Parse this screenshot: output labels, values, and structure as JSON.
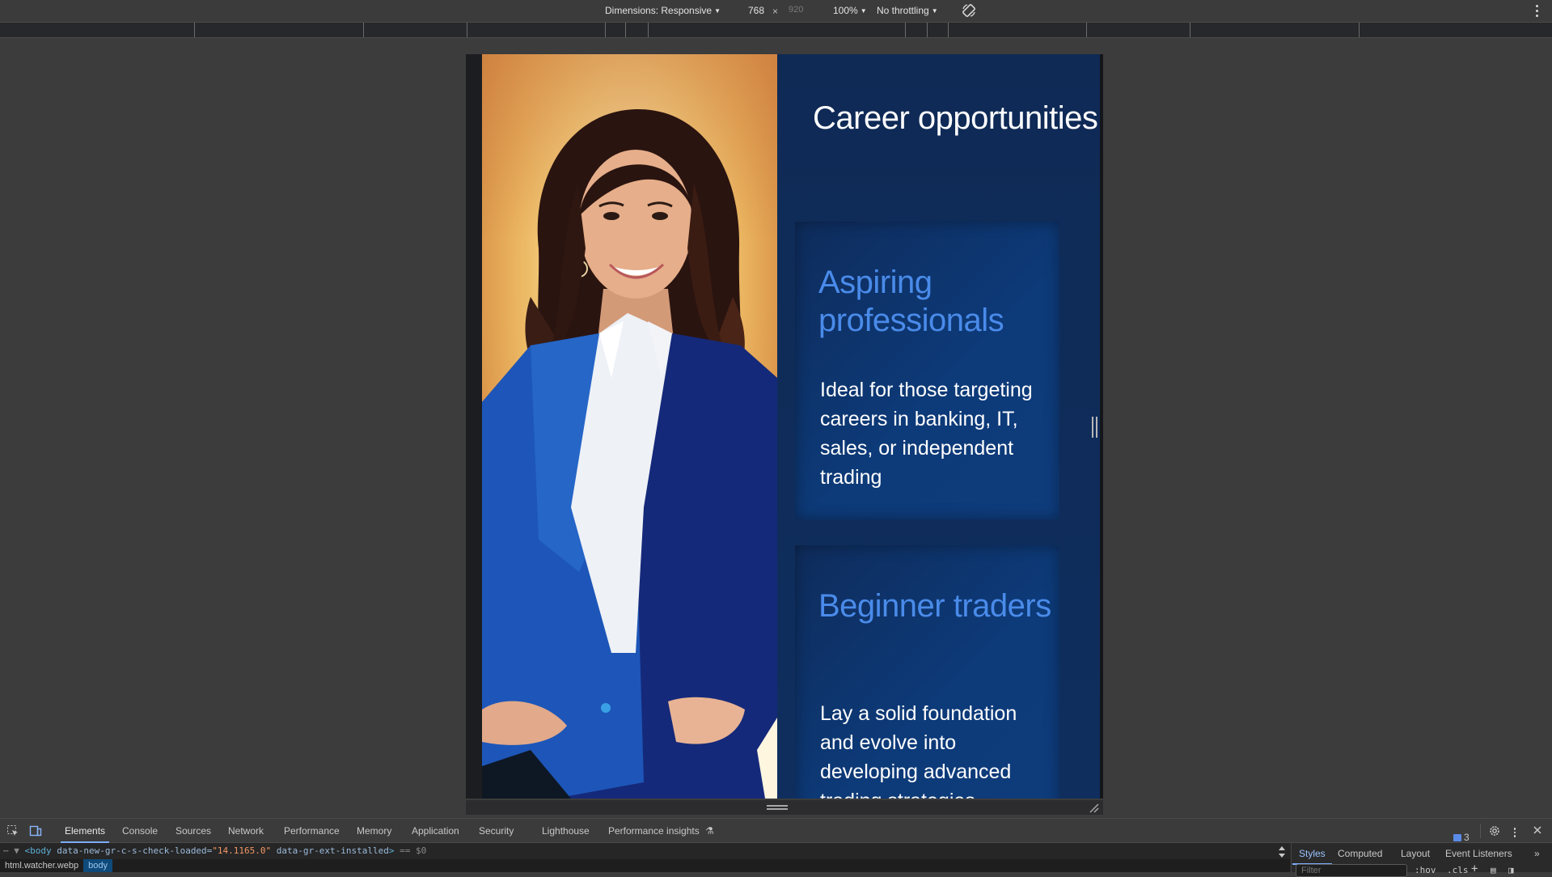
{
  "device_toolbar": {
    "dimensions_label": "Dimensions: Responsive",
    "width_value": "768",
    "times_symbol": "×",
    "height_value": "920",
    "zoom_label": "100%",
    "throttle_label": "No throttling",
    "rotate_icon": "rotate-icon",
    "more_icon": "more-vertical-icon"
  },
  "page": {
    "title": "Career opportunities",
    "photo_alt": "Smiling businesswoman in a blue blazer with hands on hips",
    "cards": [
      {
        "heading": "Aspiring professionals",
        "body": "Ideal for those targeting careers in banking, IT, sales, or independent trading"
      },
      {
        "heading": "Beginner traders",
        "body": "Lay a solid foundation and evolve into developing advanced trading strategies"
      }
    ],
    "colors": {
      "panel_bg": "#0f2a55",
      "card_bg": "#0d3a78",
      "heading_accent": "#4a8bea",
      "text": "#ffffff"
    }
  },
  "devtools": {
    "tabs": [
      "Elements",
      "Console",
      "Sources",
      "Network",
      "Performance",
      "Memory",
      "Application",
      "Security",
      "Lighthouse",
      "Performance insights"
    ],
    "active_tab": "Elements",
    "issues_count": "3",
    "dom_line": {
      "prefix": "⋯ ▼",
      "tag_open": "<body",
      "attr1_name": "data-new-gr-c-s-check-loaded",
      "attr1_value": "\"14.1165.0\"",
      "attr2_name": "data-gr-ext-installed",
      "tag_close": ">",
      "selected_marker": "== $0"
    },
    "breadcrumbs": [
      "html.watcher.webp",
      "body"
    ],
    "side_tabs": [
      "Styles",
      "Computed",
      "Layout",
      "Event Listeners"
    ],
    "active_side_tab": "Styles",
    "side_more": "»",
    "filter_placeholder": "Filter",
    "hov_label": ":hov",
    "cls_label": ".cls",
    "add_label": "+"
  }
}
